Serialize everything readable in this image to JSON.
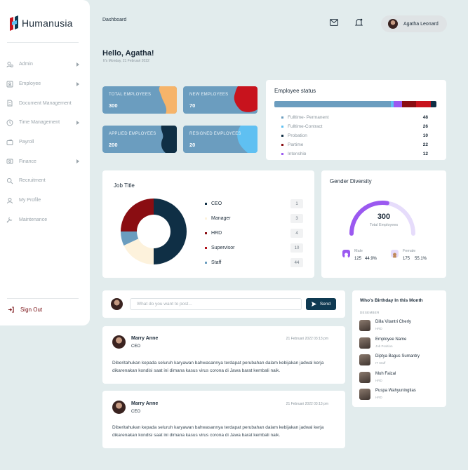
{
  "brand": {
    "name": "Humanusia"
  },
  "sidebar": {
    "items": [
      {
        "label": "Admin",
        "icon": "admin-icon",
        "has_submenu": true
      },
      {
        "label": "Employee",
        "icon": "employee-icon",
        "has_submenu": true
      },
      {
        "label": "Document Management",
        "icon": "document-icon",
        "has_submenu": false
      },
      {
        "label": "Time Management",
        "icon": "clock-icon",
        "has_submenu": true
      },
      {
        "label": "Payroll",
        "icon": "wallet-icon",
        "has_submenu": false
      },
      {
        "label": "Finance",
        "icon": "finance-icon",
        "has_submenu": true
      },
      {
        "label": "Recruitment",
        "icon": "search-icon",
        "has_submenu": false
      },
      {
        "label": "My Profile",
        "icon": "profile-icon",
        "has_submenu": false
      },
      {
        "label": "Maintenance",
        "icon": "maintenance-icon",
        "has_submenu": false
      }
    ],
    "signout_label": "Sign Out"
  },
  "header": {
    "breadcrumb": "Dashboard",
    "user_name": "Agatha Leonard"
  },
  "greeting": {
    "title": "Hello, Agatha!",
    "subtitle": "It's Monday, 21 Februari 2022"
  },
  "stats": [
    {
      "label": "TOTAL EMPLOYEES",
      "value": "300",
      "accent": "#f6b46a"
    },
    {
      "label": "NEW EMPLOYEES",
      "value": "70",
      "accent": "#c8131d"
    },
    {
      "label": "APPLIED EMPLOYEES",
      "value": "200",
      "accent": "#0f2f45"
    },
    {
      "label": "RESIGNED EMPLOYEES",
      "value": "20",
      "accent": "#5fc0f2"
    }
  ],
  "employee_status": {
    "title": "Employee status",
    "rows": [
      {
        "name": "Fulltime- Permanent",
        "count": "48",
        "color": "#6b9dbf",
        "share": 48
      },
      {
        "name": "Fulltime-Contract",
        "count": "26",
        "color": "#5fc0f2",
        "share": 2
      },
      {
        "name": "Probation",
        "count": "10",
        "color": "#0f2f45",
        "share": 2
      },
      {
        "name": "Partime",
        "count": "22",
        "color": "#8a0d12",
        "share": 5
      },
      {
        "name": "Intenship",
        "count": "12",
        "color": "#9b59f0",
        "share": 4
      }
    ],
    "bar_colors": [
      "#6b9dbf",
      "#5fc0f2",
      "#9b59f0",
      "#8a0d12",
      "#c8131d",
      "#0f2f45"
    ],
    "bar_shares": [
      162,
      4,
      12,
      20,
      20,
      8
    ]
  },
  "job_title": {
    "title": "Job Title",
    "items": [
      {
        "name": "CEO",
        "value": "1",
        "color": "#0f2f45"
      },
      {
        "name": "Manager",
        "value": "3",
        "color": "#fdf2dc"
      },
      {
        "name": "HRD",
        "value": "4",
        "color": "#8a0d12"
      },
      {
        "name": "Supervisor",
        "value": "10",
        "color": "#b0121b"
      },
      {
        "name": "Staff",
        "value": "44",
        "color": "#6b9dbf"
      }
    ],
    "donut_segments": [
      {
        "label": "navy",
        "fraction": 0.5,
        "color": "#0f2f45"
      },
      {
        "label": "cream",
        "fraction": 0.18,
        "color": "#fdf2dc"
      },
      {
        "label": "blue",
        "fraction": 0.07,
        "color": "#6b9dbf"
      },
      {
        "label": "maroon",
        "fraction": 0.25,
        "color": "#8a0d12"
      }
    ]
  },
  "gender": {
    "title": "Gender Diversity",
    "total": "300",
    "total_label": "Total Employees",
    "male_fraction": 0.55,
    "male": {
      "label": "Male",
      "count": "125",
      "percent": "44.9%",
      "color": "#9b59f0"
    },
    "female": {
      "label": "Female",
      "count": "175",
      "percent": "55.1%",
      "color": "#e6dcfb"
    }
  },
  "composer": {
    "placeholder": "What do you want to post...",
    "send_label": "Send"
  },
  "posts": [
    {
      "name": "Marry Anne",
      "role": "CEO",
      "date": "21 Februari 2022 03:13 pm",
      "body": "Diberitahukan kepada seluruh karyawan bahwasannya terdapat perubahan dalam kebijakan jadwal kerja dikarenakan kondisi saat ini dimana  kasus virus corona  di Jawa barat kembali naik."
    },
    {
      "name": "Marry Anne",
      "role": "CEO",
      "date": "21 Februari 2022 03:13 pm",
      "body": "Diberitahukan kepada seluruh karyawan bahwasannya terdapat perubahan dalam kebijakan jadwal kerja dikarenakan kondisi saat ini dimana  kasus virus corona  di Jawa barat kembali naik."
    }
  ],
  "birthdays": {
    "title": "Who's Birthday In this Month",
    "month": "DESEMBER",
    "people": [
      {
        "name": "Dilla Vitantri Cherly",
        "role": "HRD"
      },
      {
        "name": "Employee Name",
        "role": "Job Position"
      },
      {
        "name": "Diptya Bagus Sumantry",
        "role": "IT Staff"
      },
      {
        "name": "Muh Faizal",
        "role": "HRD"
      },
      {
        "name": "Puspa Wahyuningtias",
        "role": "HRD"
      }
    ]
  }
}
